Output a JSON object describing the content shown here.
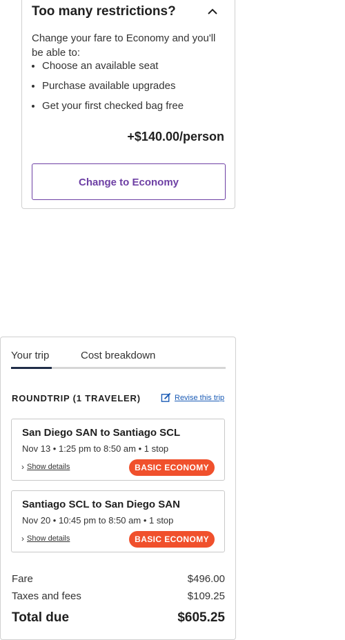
{
  "restrictions": {
    "title": "Too many restrictions?",
    "description": "Change your fare to Economy and you'll be able to:",
    "benefits": [
      "Choose an available seat",
      "Purchase available upgrades",
      "Get your first checked bag free"
    ],
    "price": "+$140.00/person",
    "button_label": "Change to Economy"
  },
  "summary": {
    "tabs": [
      "Your trip",
      "Cost breakdown"
    ],
    "trip_heading": "ROUNDTRIP (1 TRAVELER)",
    "revise_label": "Revise this trip",
    "segments": [
      {
        "route": "San Diego SAN to Santiago SCL",
        "details": "Nov 13 • 1:25 pm to 8:50 am • 1 stop",
        "show_details": "Show details",
        "fare_badge": "BASIC ECONOMY"
      },
      {
        "route": "Santiago SCL to San Diego SAN",
        "details": "Nov 20 • 10:45 pm to 8:50 am • 1 stop",
        "show_details": "Show details",
        "fare_badge": "BASIC ECONOMY"
      }
    ],
    "costs": {
      "fare_label": "Fare",
      "fare_value": "$496.00",
      "taxes_label": "Taxes and fees",
      "taxes_value": "$109.25",
      "total_label": "Total due",
      "total_value": "$605.25"
    }
  },
  "colors": {
    "accent_purple": "#6d3fa4",
    "badge_orange": "#f0502c",
    "link_blue": "#1a5bb5",
    "tab_active": "#1f2d47"
  }
}
